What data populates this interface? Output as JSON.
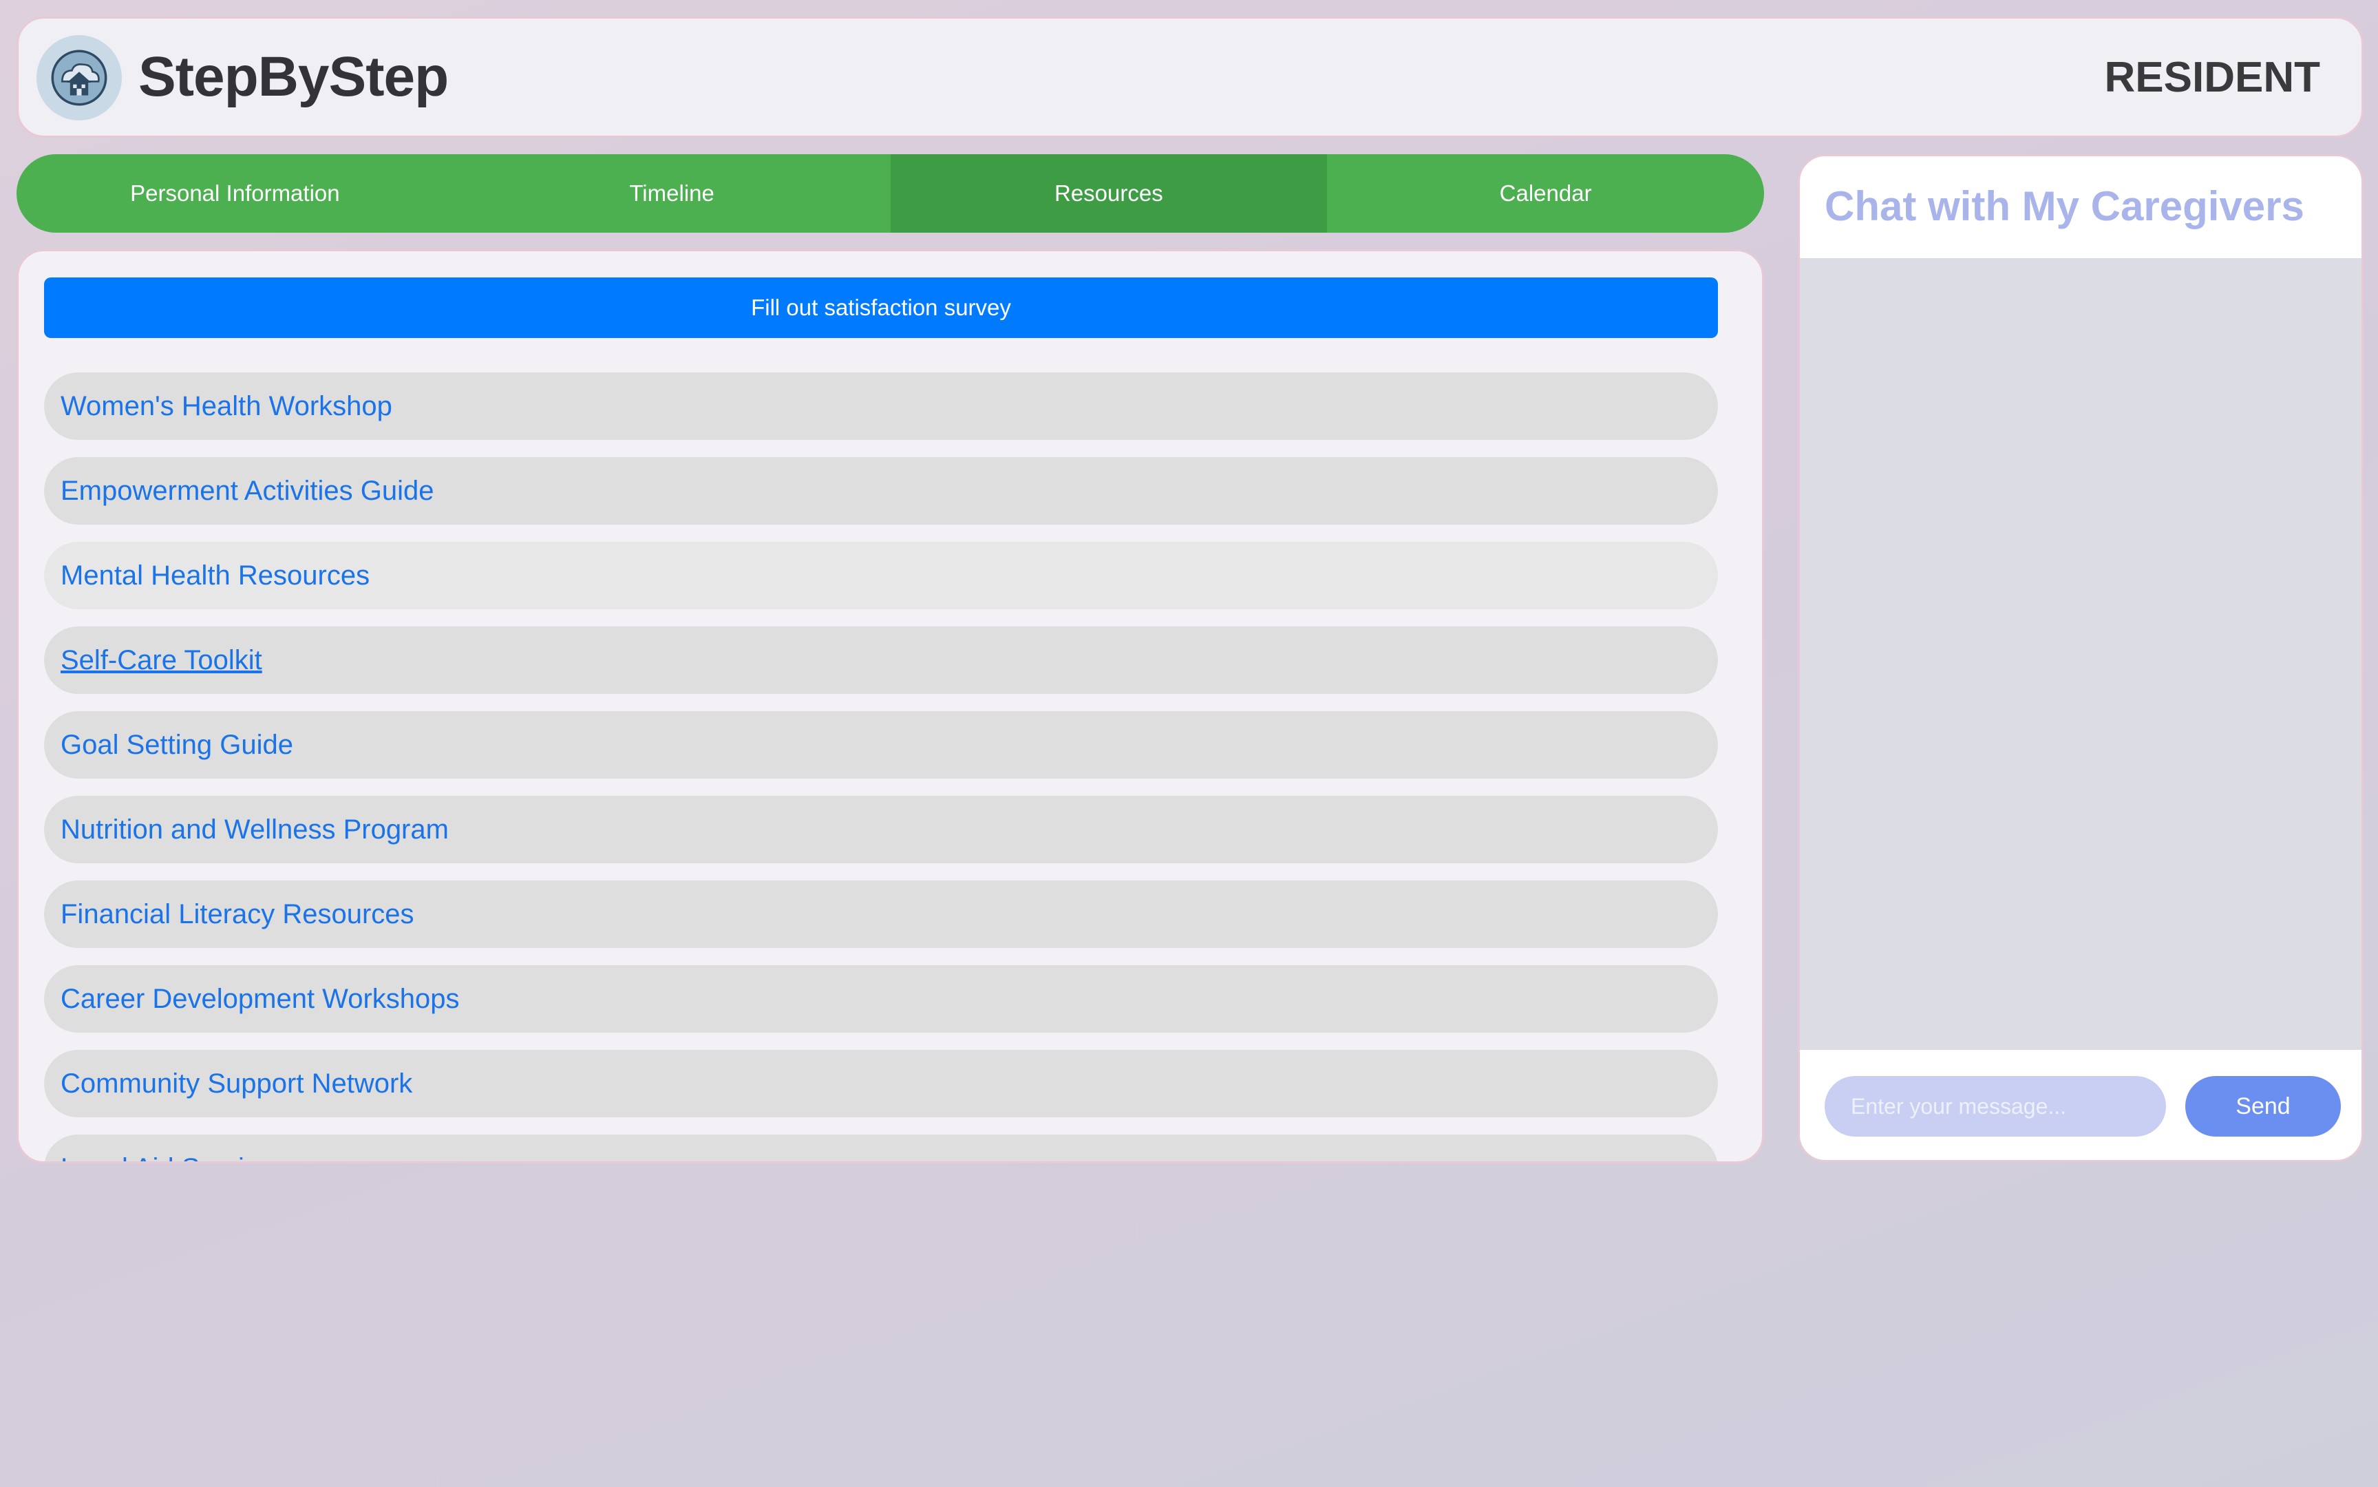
{
  "header": {
    "brand": "StepByStep",
    "role": "RESIDENT",
    "logo_icon": "house-icon"
  },
  "tabs": [
    {
      "label": "Personal Information",
      "active": false
    },
    {
      "label": "Timeline",
      "active": false
    },
    {
      "label": "Resources",
      "active": true
    },
    {
      "label": "Calendar",
      "active": false
    }
  ],
  "resources": {
    "survey_label": "Fill out satisfaction survey",
    "items": [
      {
        "label": "Women's Health Workshop"
      },
      {
        "label": "Empowerment Activities Guide"
      },
      {
        "label": "Mental Health Resources"
      },
      {
        "label": "Self-Care Toolkit"
      },
      {
        "label": "Goal Setting Guide"
      },
      {
        "label": "Nutrition and Wellness Program"
      },
      {
        "label": "Financial Literacy Resources"
      },
      {
        "label": "Career Development Workshops"
      },
      {
        "label": "Community Support Network"
      },
      {
        "label": "Legal Aid Services"
      }
    ]
  },
  "chat": {
    "title": "Chat with My Caregivers",
    "input_placeholder": "Enter your message...",
    "send_label": "Send"
  },
  "colors": {
    "tab_bar": "#4caf50",
    "tab_active": "#3e9d44",
    "survey_button": "#007bff",
    "link_text": "#1a73e8",
    "chat_title": "#a9b4ea",
    "send_button": "#6a8ff0"
  }
}
